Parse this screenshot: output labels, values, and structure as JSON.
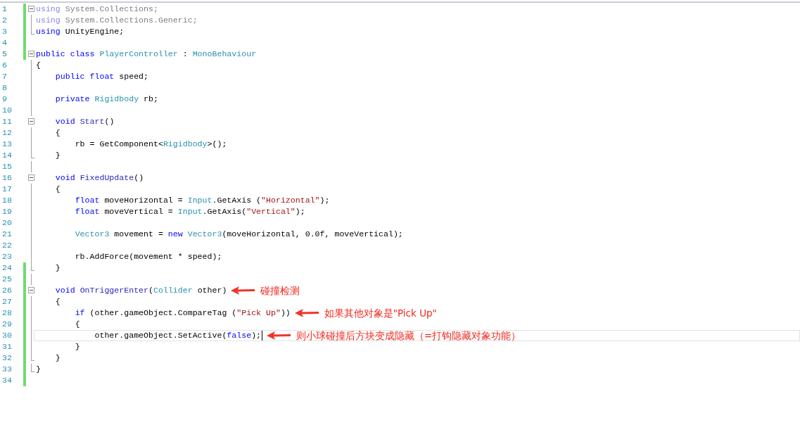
{
  "editor": {
    "lines": [
      {
        "number": "1",
        "changed": true,
        "kind": "fold-start",
        "expanded": true,
        "tokens": [
          {
            "text": "using",
            "kind": "dim-keyword"
          },
          {
            "text": " System.Collections;",
            "kind": "dim"
          }
        ]
      },
      {
        "number": "2",
        "changed": true,
        "kind": "fold-inside",
        "tokens": [
          {
            "text": "using",
            "kind": "dim-keyword"
          },
          {
            "text": " System.Collections.Generic;",
            "kind": "dim"
          }
        ]
      },
      {
        "number": "3",
        "changed": true,
        "kind": "fold-end",
        "tokens": [
          {
            "text": "using",
            "kind": "keyword"
          },
          {
            "text": " UnityEngine;",
            "kind": "plain"
          }
        ]
      },
      {
        "number": "4",
        "changed": true
      },
      {
        "number": "5",
        "changed": true,
        "kind": "fold-start",
        "expanded": true,
        "tokens": [
          {
            "text": "public class",
            "kind": "keyword"
          },
          {
            "text": " PlayerController",
            "kind": "type"
          },
          {
            "text": " : ",
            "kind": "plain"
          },
          {
            "text": "MonoBehaviour",
            "kind": "type"
          }
        ]
      },
      {
        "number": "6",
        "changed": false,
        "kind": "fold-inside",
        "tokens": [
          {
            "text": "{",
            "kind": "plain"
          }
        ]
      },
      {
        "number": "7",
        "changed": false,
        "kind": "fold-inside",
        "tokens": [
          {
            "text": "    public float",
            "kind": "keyword"
          },
          {
            "text": " speed;",
            "kind": "plain"
          }
        ]
      },
      {
        "number": "8",
        "changed": false,
        "kind": "fold-inside"
      },
      {
        "number": "9",
        "changed": false,
        "kind": "fold-inside",
        "tokens": [
          {
            "text": "    private",
            "kind": "keyword"
          },
          {
            "text": " Rigidbody",
            "kind": "type"
          },
          {
            "text": " rb;",
            "kind": "plain"
          }
        ]
      },
      {
        "number": "10",
        "changed": false,
        "kind": "fold-inside"
      },
      {
        "number": "11",
        "changed": false,
        "kind": "fold-start",
        "expanded": true,
        "tokens": [
          {
            "text": "    void",
            "kind": "keyword"
          },
          {
            "text": " Start",
            "kind": "method"
          },
          {
            "text": "()",
            "kind": "plain"
          }
        ]
      },
      {
        "number": "12",
        "changed": false,
        "kind": "fold-inside",
        "tokens": [
          {
            "text": "    {",
            "kind": "plain"
          }
        ]
      },
      {
        "number": "13",
        "changed": false,
        "kind": "fold-inside",
        "tokens": [
          {
            "text": "        rb = GetComponent<",
            "kind": "plain"
          },
          {
            "text": "Rigidbody",
            "kind": "type"
          },
          {
            "text": ">();",
            "kind": "plain"
          }
        ]
      },
      {
        "number": "14",
        "changed": false,
        "kind": "fold-end",
        "tokens": [
          {
            "text": "    }",
            "kind": "plain"
          }
        ]
      },
      {
        "number": "15",
        "changed": false,
        "kind": "fold-inside"
      },
      {
        "number": "16",
        "changed": false,
        "kind": "fold-start",
        "expanded": true,
        "tokens": [
          {
            "text": "    void",
            "kind": "keyword"
          },
          {
            "text": " FixedUpdate",
            "kind": "method"
          },
          {
            "text": "()",
            "kind": "plain"
          }
        ]
      },
      {
        "number": "17",
        "changed": false,
        "kind": "fold-inside",
        "tokens": [
          {
            "text": "    {",
            "kind": "plain"
          }
        ]
      },
      {
        "number": "18",
        "changed": false,
        "kind": "fold-inside",
        "tokens": [
          {
            "text": "        float",
            "kind": "keyword"
          },
          {
            "text": " moveHorizontal = ",
            "kind": "plain"
          },
          {
            "text": "Input",
            "kind": "type"
          },
          {
            "text": ".GetAxis (",
            "kind": "plain"
          },
          {
            "text": "\"Horizontal\"",
            "kind": "string"
          },
          {
            "text": ");",
            "kind": "plain"
          }
        ]
      },
      {
        "number": "19",
        "changed": false,
        "kind": "fold-inside",
        "tokens": [
          {
            "text": "        float",
            "kind": "keyword"
          },
          {
            "text": " moveVertical = ",
            "kind": "plain"
          },
          {
            "text": "Input",
            "kind": "type"
          },
          {
            "text": ".GetAxis(",
            "kind": "plain"
          },
          {
            "text": "\"Vertical\"",
            "kind": "string"
          },
          {
            "text": ");",
            "kind": "plain"
          }
        ]
      },
      {
        "number": "20",
        "changed": false,
        "kind": "fold-inside"
      },
      {
        "number": "21",
        "changed": false,
        "kind": "fold-inside",
        "tokens": [
          {
            "text": "        Vector3",
            "kind": "type"
          },
          {
            "text": " movement = ",
            "kind": "plain"
          },
          {
            "text": "new",
            "kind": "keyword"
          },
          {
            "text": " Vector3",
            "kind": "type"
          },
          {
            "text": "(moveHorizontal, 0.0f, moveVertical);",
            "kind": "plain"
          }
        ]
      },
      {
        "number": "22",
        "changed": false,
        "kind": "fold-inside"
      },
      {
        "number": "23",
        "changed": false,
        "kind": "fold-inside",
        "tokens": [
          {
            "text": "        rb.AddForce(movement * speed);",
            "kind": "plain"
          }
        ]
      },
      {
        "number": "24",
        "changed": true,
        "kind": "fold-end",
        "tokens": [
          {
            "text": "    }",
            "kind": "plain"
          }
        ]
      },
      {
        "number": "25",
        "changed": true,
        "kind": "fold-inside"
      },
      {
        "number": "26",
        "changed": true,
        "kind": "fold-start",
        "expanded": true,
        "tokens": [
          {
            "text": "    void",
            "kind": "keyword"
          },
          {
            "text": " OnTriggerEnter",
            "kind": "method"
          },
          {
            "text": "(",
            "kind": "plain"
          },
          {
            "text": "Collider",
            "kind": "type"
          },
          {
            "text": " other)",
            "kind": "plain"
          }
        ],
        "note": "碰撞检测"
      },
      {
        "number": "27",
        "changed": true,
        "kind": "fold-inside",
        "tokens": [
          {
            "text": "    {",
            "kind": "plain"
          }
        ]
      },
      {
        "number": "28",
        "changed": true,
        "kind": "fold-inside",
        "tokens": [
          {
            "text": "        if",
            "kind": "keyword"
          },
          {
            "text": " (other.gameObject.CompareTag (",
            "kind": "plain"
          },
          {
            "text": "\"Pick Up\"",
            "kind": "string"
          },
          {
            "text": "))",
            "kind": "plain"
          }
        ],
        "note": "如果其他对象是\"Pick Up\""
      },
      {
        "number": "29",
        "changed": true,
        "kind": "fold-inside",
        "tokens": [
          {
            "text": "        {",
            "kind": "plain"
          }
        ]
      },
      {
        "number": "30",
        "changed": true,
        "kind": "fold-inside",
        "current": true,
        "tokens": [
          {
            "text": "            other.gameObject.SetActive(",
            "kind": "plain"
          },
          {
            "text": "false",
            "kind": "keyword"
          },
          {
            "text": ");",
            "kind": "plain"
          }
        ],
        "note": "则小球碰撞后方块变成隐藏（=打钩隐藏对象功能）"
      },
      {
        "number": "31",
        "changed": true,
        "kind": "fold-inside",
        "tokens": [
          {
            "text": "        }",
            "kind": "plain"
          }
        ]
      },
      {
        "number": "32",
        "changed": true,
        "kind": "fold-end",
        "tokens": [
          {
            "text": "    }",
            "kind": "plain"
          }
        ]
      },
      {
        "number": "33",
        "changed": true,
        "kind": "fold-end",
        "tokens": [
          {
            "text": "}",
            "kind": "plain"
          }
        ]
      },
      {
        "number": "34",
        "changed": true
      }
    ]
  }
}
